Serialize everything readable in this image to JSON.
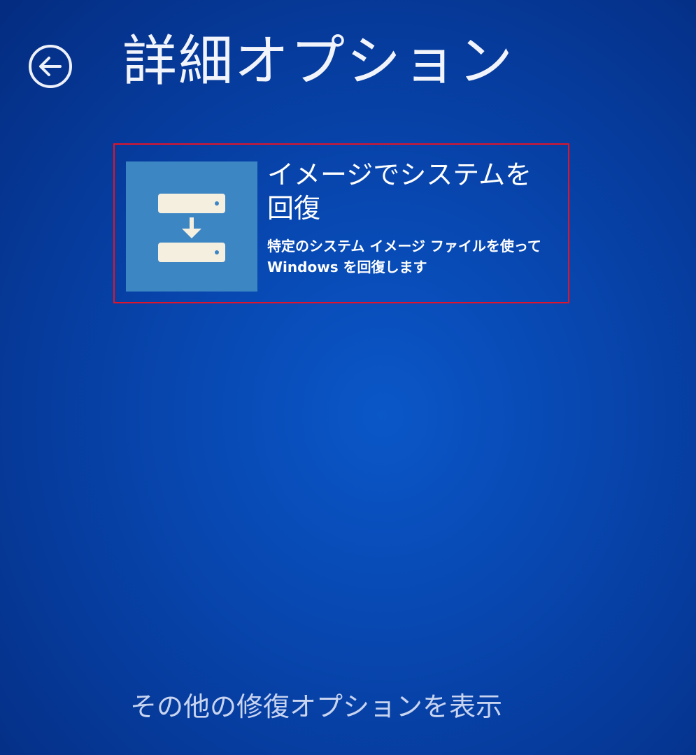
{
  "header": {
    "title": "詳細オプション",
    "back_icon": "back-arrow-icon"
  },
  "options": [
    {
      "title": "イメージでシステムを回復",
      "description": "特定のシステム イメージ ファイルを使って Windows を回復します",
      "icon": "system-image-recovery-icon",
      "highlight_color": "#e0142a"
    }
  ],
  "footer": {
    "more_options_link": "その他の修復オプションを表示"
  }
}
